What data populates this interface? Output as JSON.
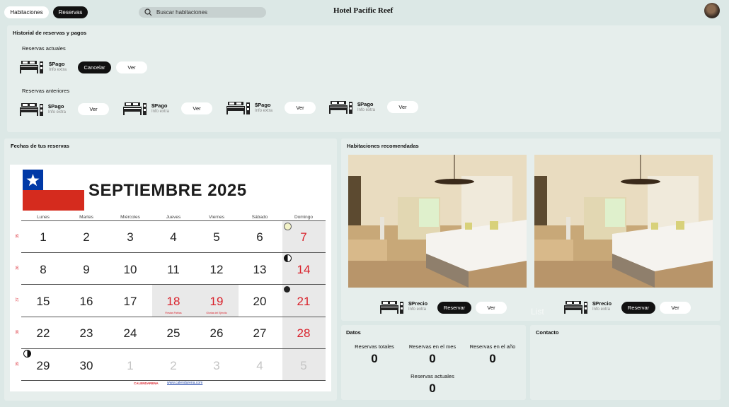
{
  "header": {
    "tab_rooms": "Habitaciones",
    "tab_bookings": "Reservas",
    "search_placeholder": "Buscar habitaciones",
    "brand": "Hotel Pacific Reef"
  },
  "history": {
    "title": "Historial de reservas y pagos",
    "current_label": "Reservas actuales",
    "previous_label": "Reservas anteriores",
    "current": [
      {
        "pay": "$Pago",
        "info": "Info extra",
        "cancel": "Cancelar",
        "view": "Ver"
      }
    ],
    "previous": [
      {
        "pay": "$Pago",
        "info": "Info extra",
        "view": "Ver"
      },
      {
        "pay": "$Pago",
        "info": "Info extra",
        "view": "Ver"
      },
      {
        "pay": "$Pago",
        "info": "Info extra",
        "view": "Ver"
      },
      {
        "pay": "$Pago",
        "info": "Info extra",
        "view": "Ver"
      }
    ]
  },
  "calendar_panel": {
    "title": "Fechas de tus reservas",
    "month_title": "SEPTIEMBRE 2025",
    "days_of_week": [
      "Lunes",
      "Martes",
      "Miércoles",
      "Jueves",
      "Viernes",
      "Sábado",
      "Domingo"
    ],
    "weeks": [
      {
        "num": "35",
        "days": [
          "1",
          "2",
          "3",
          "4",
          "5",
          "6",
          "7"
        ]
      },
      {
        "num": "36",
        "days": [
          "8",
          "9",
          "10",
          "11",
          "12",
          "13",
          "14"
        ]
      },
      {
        "num": "37",
        "days": [
          "15",
          "16",
          "17",
          "18",
          "19",
          "20",
          "21"
        ]
      },
      {
        "num": "38",
        "days": [
          "22",
          "23",
          "24",
          "25",
          "26",
          "27",
          "28"
        ]
      },
      {
        "num": "39",
        "days": [
          "29",
          "30",
          "1",
          "2",
          "3",
          "4",
          "5"
        ]
      }
    ],
    "holiday_notes": [
      "Fiestas Patrias",
      "Glorias del Ejército"
    ],
    "footer_brand": "CALENDARENA",
    "footer_url": "www.calendarena.com",
    "colors": {
      "flag_red": "#d52b1e",
      "flag_blue": "#0039a6",
      "holiday": "#d9212b"
    }
  },
  "recommended": {
    "title": "Habitaciones recomendadas",
    "rooms": [
      {
        "price": "$Precio",
        "info": "Info extra",
        "book": "Reservar",
        "view": "Ver"
      },
      {
        "price": "$Precio",
        "info": "Info extra",
        "book": "Reservar",
        "view": "Ver"
      }
    ],
    "watermark": "List"
  },
  "stats": {
    "title": "Datos",
    "items": [
      {
        "label": "Reservas totales",
        "value": "0"
      },
      {
        "label": "Reservas en el mes",
        "value": "0"
      },
      {
        "label": "Reservas en el año",
        "value": "0"
      },
      {
        "label": "Reservas actuales",
        "value": "0"
      }
    ]
  },
  "contact": {
    "title": "Contacto"
  }
}
